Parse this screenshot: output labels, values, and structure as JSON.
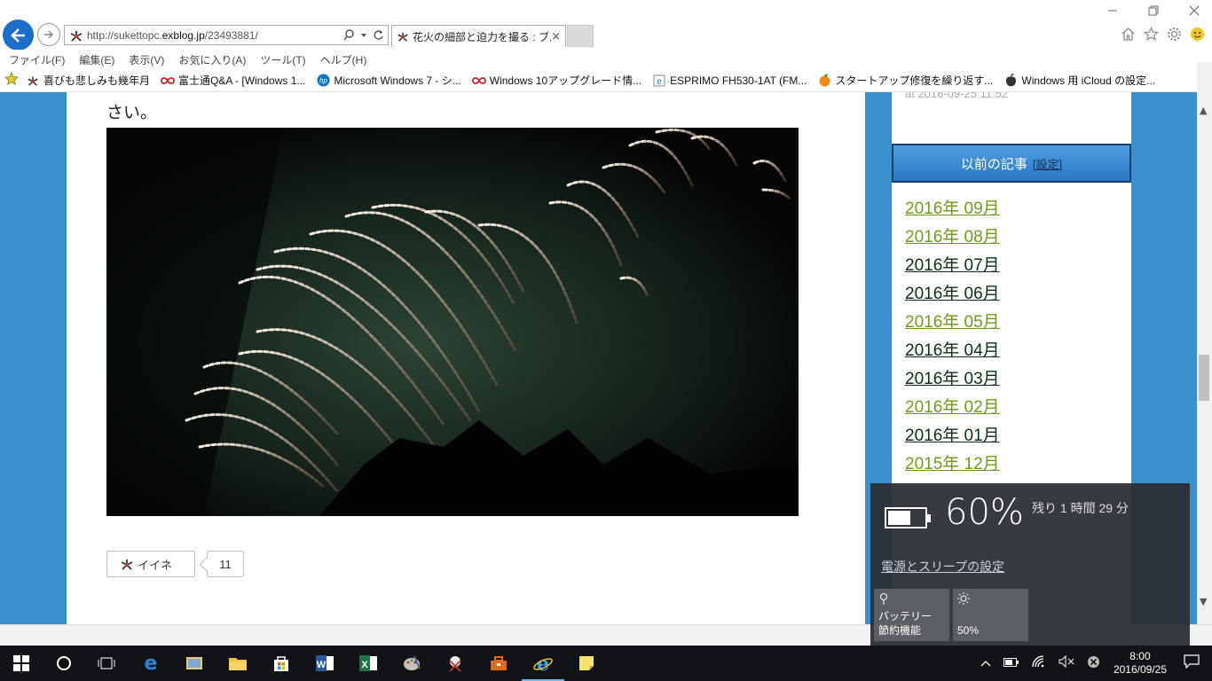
{
  "browser": {
    "url_prefix": "http://sukettopc.",
    "url_domain": "exblog.jp",
    "url_suffix": "/23493881/",
    "tab_title": "花火の細部と迫力を撮る : ブ...",
    "tab_close": "×"
  },
  "menubar": [
    "ファイル(F)",
    "編集(E)",
    "表示(V)",
    "お気に入り(A)",
    "ツール(T)",
    "ヘルプ(H)"
  ],
  "favorites": [
    {
      "label": "喜びも悲しみも幾年月",
      "icon": "exblog-icon"
    },
    {
      "label": "富士通Q&A - [Windows 1...",
      "icon": "fujitsu-infinity-icon"
    },
    {
      "label": "Microsoft Windows 7 - シ...",
      "icon": "hp-icon"
    },
    {
      "label": "Windows 10アップグレード情...",
      "icon": "fujitsu-infinity-icon"
    },
    {
      "label": "ESPRIMO FH530-1AT (FM...",
      "icon": "ie-page-icon"
    },
    {
      "label": "スタートアップ修復を繰り返す...",
      "icon": "orange-icon"
    },
    {
      "label": "Windows 用 iCloud の設定...",
      "icon": "apple-icon"
    }
  ],
  "post": {
    "text_tail": "さい。",
    "like_label": "イイネ",
    "like_count": "11"
  },
  "sidebar": {
    "date_fragment": "at 2016-09-25 11:52",
    "archive_title": "以前の記事",
    "archive_settings": "[設定]",
    "archive": [
      {
        "label": "2016年 09月",
        "visited": false
      },
      {
        "label": "2016年 08月",
        "visited": false
      },
      {
        "label": "2016年 07月",
        "visited": true
      },
      {
        "label": "2016年 06月",
        "visited": true
      },
      {
        "label": "2016年 05月",
        "visited": false
      },
      {
        "label": "2016年 04月",
        "visited": true
      },
      {
        "label": "2016年 03月",
        "visited": true
      },
      {
        "label": "2016年 02月",
        "visited": false
      },
      {
        "label": "2016年 01月",
        "visited": true
      },
      {
        "label": "2015年 12月",
        "visited": false
      }
    ],
    "link_color": "#6f9a1e",
    "visited_color": "#0d2f13"
  },
  "battery": {
    "percent": "60%",
    "level": 0.6,
    "remaining": "残り 1 時間 29 分",
    "power_link": "電源とスリープの設定",
    "saver_label_1": "バッテリー",
    "saver_label_2": "節約機能",
    "brightness_label": "50%"
  },
  "taskbar": {
    "time": "8:00",
    "date": "2016/09/25"
  }
}
